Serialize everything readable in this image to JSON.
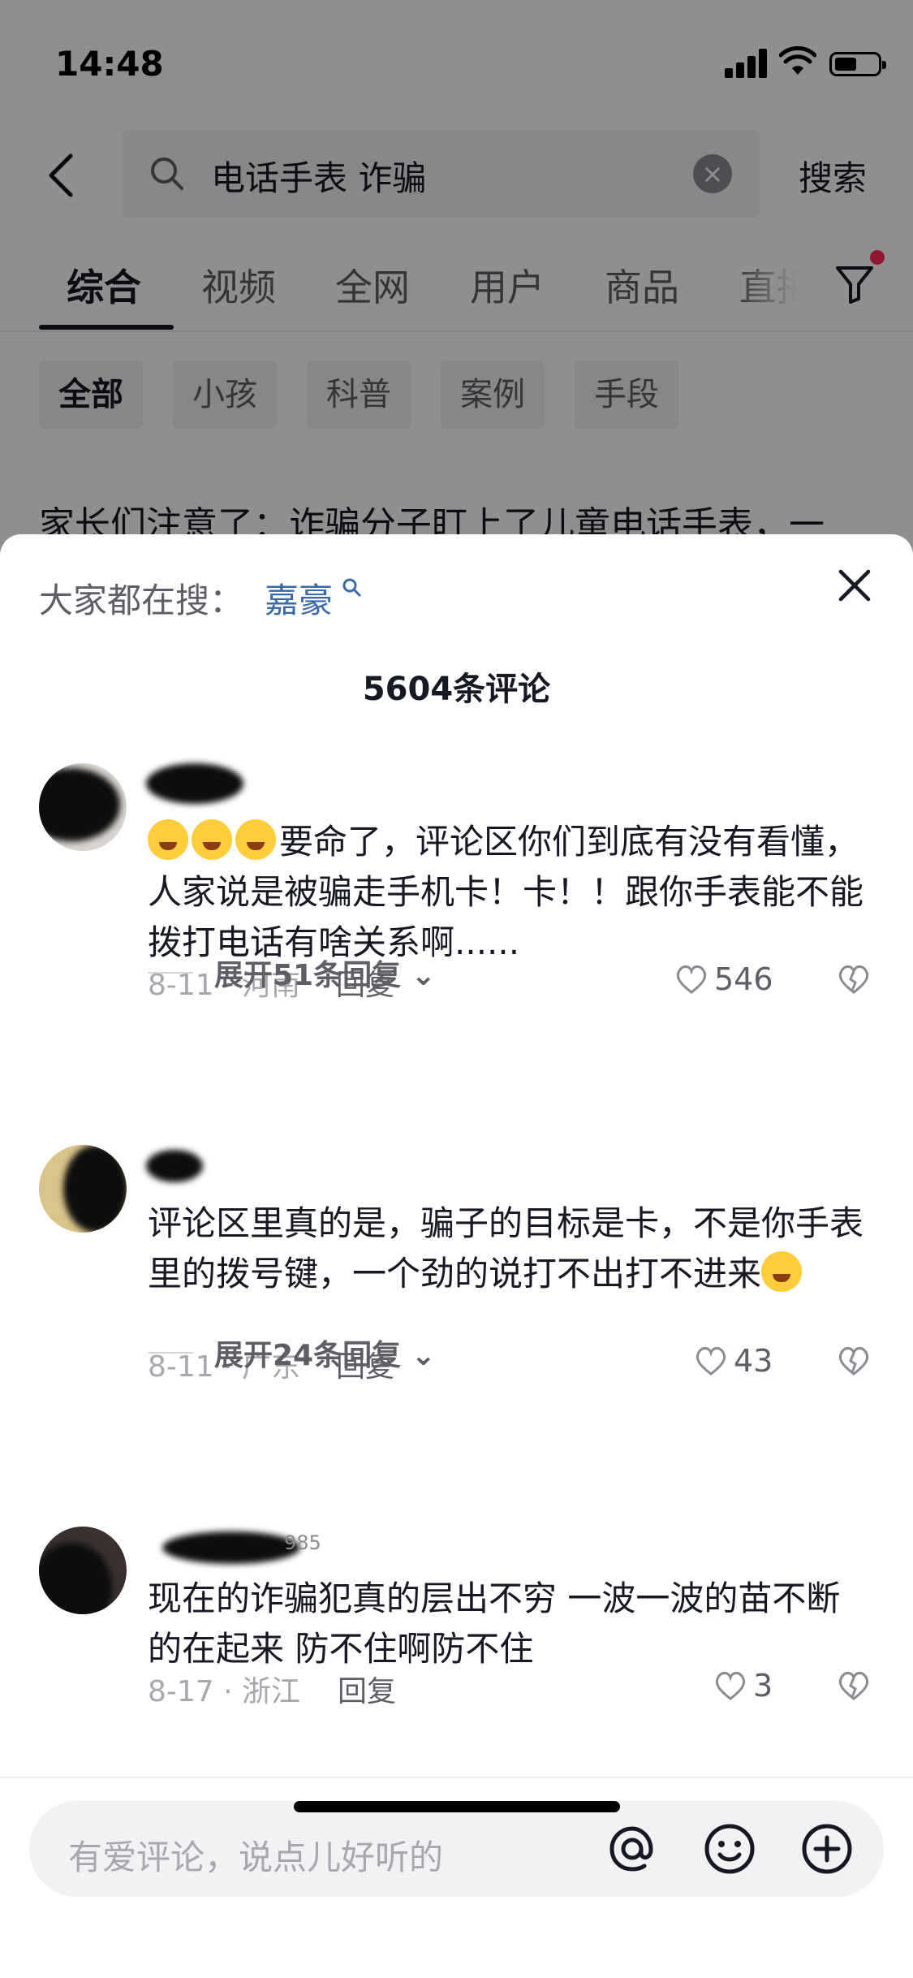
{
  "status_bar": {
    "time": "14:48"
  },
  "search": {
    "query": "电话手表 诈骗",
    "submit_label": "搜索"
  },
  "tabs": [
    "综合",
    "视频",
    "全网",
    "用户",
    "商品",
    "直播"
  ],
  "chips": [
    "全部",
    "小孩",
    "科普",
    "案例",
    "手段"
  ],
  "background_snippet": "家长们注意了：诈骗分子盯上了儿童电话手表，一",
  "sheet": {
    "trending_label": "大家都在搜：",
    "trending_keyword": "嘉豪",
    "comment_count_label": "5604条评论"
  },
  "comments": [
    {
      "text": "要命了，评论区你们到底有没有看懂，人家说是被骗走手机卡！卡！！跟你手表能不能拨打电话有啥关系啊......",
      "date_location": "8-11 · 河南",
      "reply_label": "回复",
      "likes": "546",
      "expand_label": "展开51条回复"
    },
    {
      "text": "评论区里真的是，骗子的目标是卡，不是你手表里的拨号键，一个劲的说打不出打不进来",
      "date_location": "8-11 · 广东",
      "reply_label": "回复",
      "likes": "43",
      "expand_label": "展开24条回复"
    },
    {
      "username_suffix": "985",
      "text": "现在的诈骗犯真的层出不穷 一波一波的苗不断的在起来 防不住啊防不住",
      "date_location": "8-17 · 浙江",
      "reply_label": "回复",
      "likes": "3"
    }
  ],
  "input": {
    "placeholder": "有爱评论，说点儿好听的"
  },
  "colors": {
    "accent_dot": "#fe2c55",
    "keyword_blue": "#3a6aa6"
  }
}
